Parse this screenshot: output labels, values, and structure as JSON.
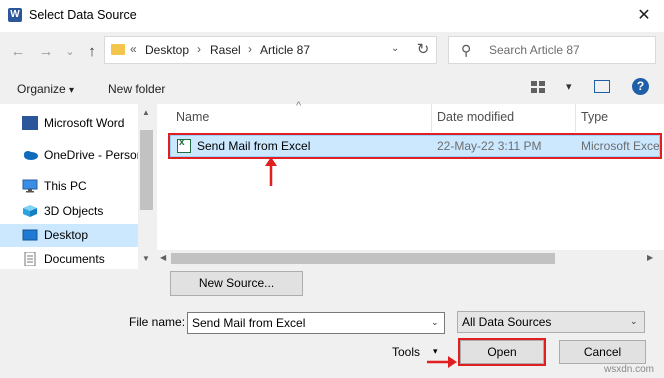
{
  "window": {
    "title": "Select Data Source",
    "close_glyph": "✕"
  },
  "nav": {
    "back": "←",
    "forward": "→",
    "recent": "⌄",
    "up": "↑"
  },
  "address": {
    "overflow": "«",
    "crumbs": [
      "Desktop",
      "Rasel",
      "Article 87"
    ],
    "separator": "›",
    "dropdown": "⌄",
    "refresh": "↻"
  },
  "search": {
    "placeholder": "Search Article 87",
    "icon": "⚲"
  },
  "toolbar": {
    "organize": "Organize",
    "new_folder": "New folder",
    "view_dd": "▾",
    "help": "?",
    "organize_dd": "▾"
  },
  "nav_pane": {
    "items": [
      {
        "label": "Microsoft Word",
        "icon": "word-icon"
      },
      {
        "label": "OneDrive - Person",
        "icon": "onedrive-icon"
      },
      {
        "label": "This PC",
        "icon": "pc-icon"
      },
      {
        "label": "3D Objects",
        "icon": "cube-icon"
      },
      {
        "label": "Desktop",
        "icon": "desktop-icon",
        "selected": true
      },
      {
        "label": "Documents",
        "icon": "documents-icon"
      }
    ]
  },
  "file_list": {
    "columns": {
      "name": "Name",
      "date": "Date modified",
      "type": "Type"
    },
    "sort_indicator": "^",
    "rows": [
      {
        "name": "Send Mail from Excel",
        "date": "22-May-22 3:11 PM",
        "type": "Microsoft Excel",
        "selected": true
      }
    ]
  },
  "buttons": {
    "new_source": "New Source...",
    "open": "Open",
    "cancel": "Cancel",
    "tools": "Tools",
    "tools_dd": "▾"
  },
  "filename": {
    "label": "File name:",
    "value": "Send Mail from Excel",
    "dd": "⌄"
  },
  "filter": {
    "value": "All Data Sources",
    "dd": "⌄"
  },
  "watermark": "wsxdn.com",
  "colors": {
    "annotation_red": "#e02020",
    "selection": "#cce8ff",
    "accent": "#1f5fa8"
  }
}
